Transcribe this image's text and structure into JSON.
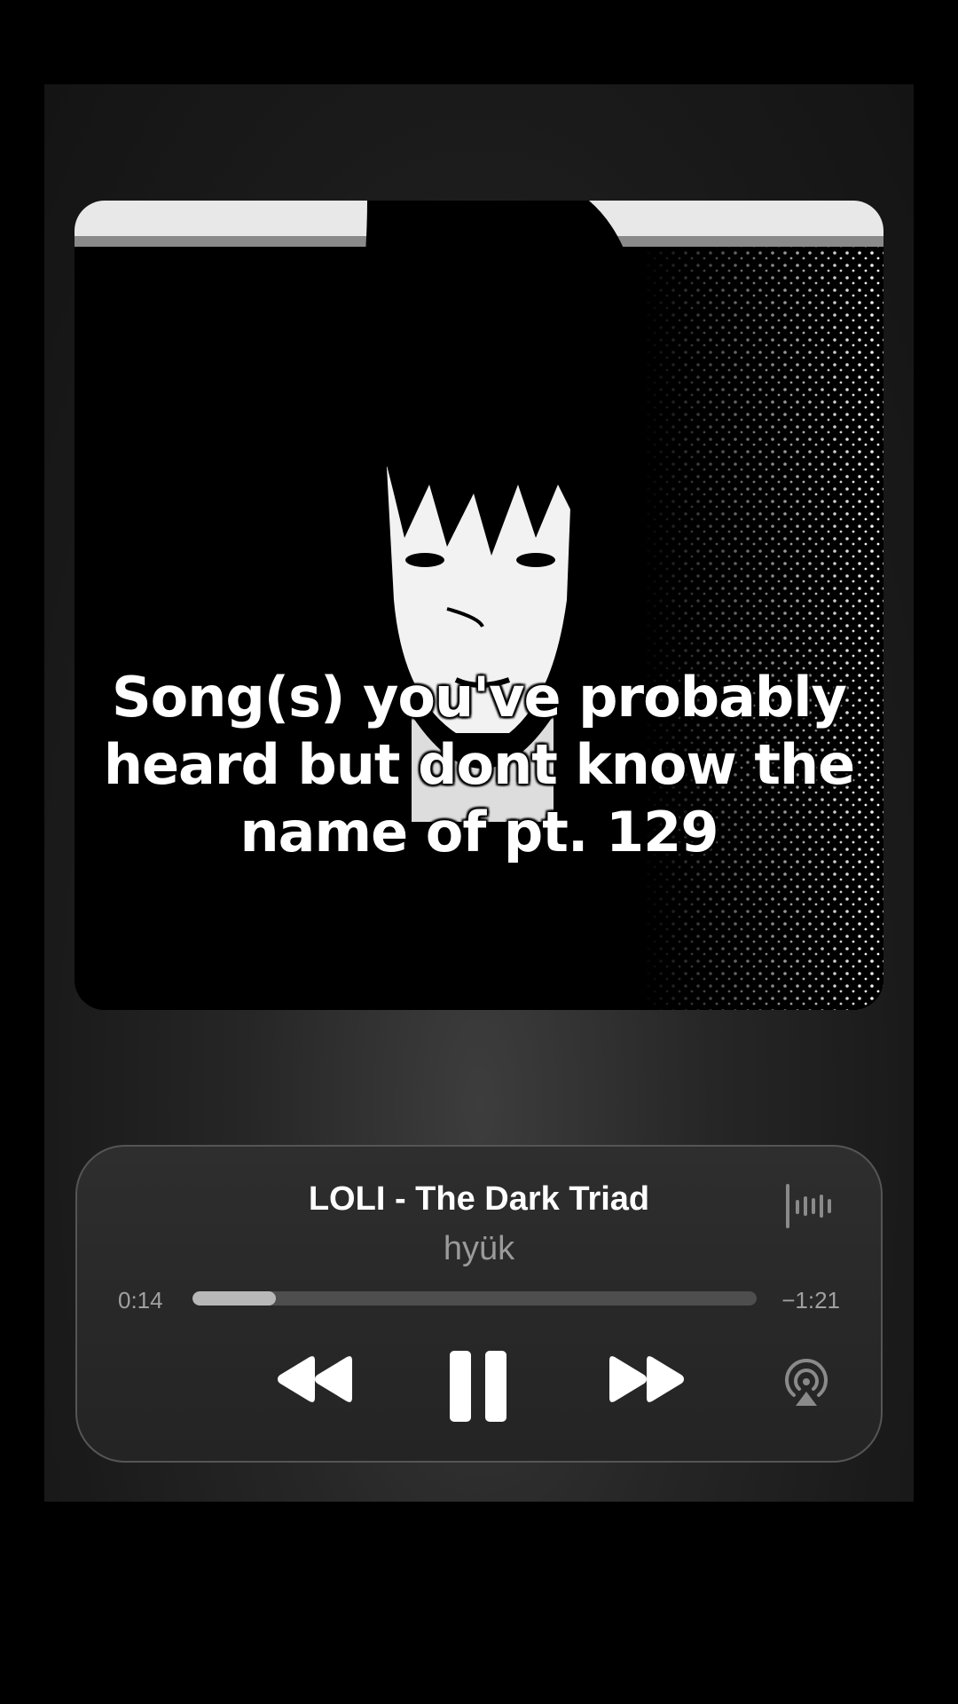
{
  "overlay_caption": "Song(s) you've probably\nheard but dont know the\nname of pt. 129",
  "player": {
    "title": "LOLI - The Dark Triad",
    "artist": "hyük",
    "time_elapsed": "0:14",
    "time_remaining": "−1:21",
    "progress_fraction": 0.148
  },
  "icons": {
    "waveform": "waveform-icon",
    "rewind": "rewind-icon",
    "pause": "pause-icon",
    "forward": "fast-forward-icon",
    "airplay": "airplay-icon"
  },
  "colors": {
    "background": "#000000",
    "panel": "#282828",
    "text_primary": "#ffffff",
    "text_secondary": "#9a9a9a",
    "progress_track": "#4e4e4e",
    "progress_fill": "#b8b8b8"
  }
}
